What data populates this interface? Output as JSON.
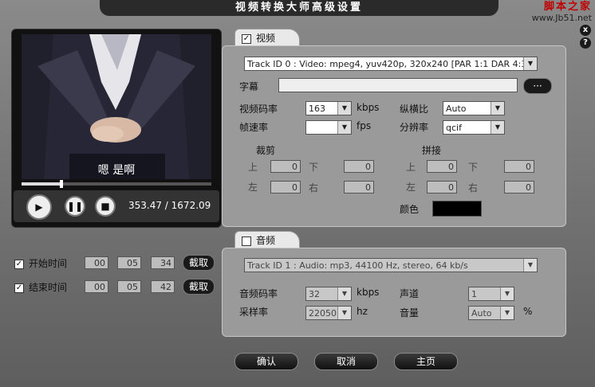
{
  "window": {
    "title": "视频转换大师高级设置"
  },
  "watermark": {
    "line1": "脚本之家",
    "line2": "www.Jb51.net"
  },
  "title_buttons": {
    "close": "x",
    "help": "?"
  },
  "player": {
    "subtitle": "嗯 是啊",
    "progress": 0.21,
    "timecode": "353.47 / 1672.09"
  },
  "clip": {
    "start": {
      "label": "开始时间",
      "h": "00",
      "m": "05",
      "s": "34",
      "capture": "截取",
      "checked": true
    },
    "end": {
      "label": "结束时间",
      "h": "00",
      "m": "05",
      "s": "42",
      "capture": "截取",
      "checked": true
    }
  },
  "video": {
    "tab_label": "视频",
    "checked": true,
    "track": "Track ID 0 : Video: mpeg4, yuv420p, 320x240 [PAR 1:1 DAR 4:3]",
    "subtitle_label": "字幕",
    "subtitle_value": "",
    "browse_label": "···",
    "bitrate_label": "视频码率",
    "bitrate_value": "163",
    "bitrate_unit": "kbps",
    "fps_label": "帧速率",
    "fps_value": "",
    "fps_unit": "fps",
    "aspect_label": "纵横比",
    "aspect_value": "Auto",
    "resolution_label": "分辨率",
    "resolution_value": "qcif",
    "crop": {
      "title": "裁剪",
      "top_label": "上",
      "top": "0",
      "bottom_label": "下",
      "bottom": "0",
      "left_label": "左",
      "left": "0",
      "right_label": "右",
      "right": "0"
    },
    "pad": {
      "title": "拼接",
      "top_label": "上",
      "top": "0",
      "bottom_label": "下",
      "bottom": "0",
      "left_label": "左",
      "left": "0",
      "right_label": "右",
      "right": "0"
    },
    "color_label": "颜色",
    "color_value": "#000000"
  },
  "audio": {
    "tab_label": "音频",
    "checked": false,
    "track": "Track ID 1 : Audio: mp3, 44100 Hz, stereo, 64 kb/s",
    "bitrate_label": "音频码率",
    "bitrate_value": "32",
    "bitrate_unit": "kbps",
    "samplerate_label": "采样率",
    "samplerate_value": "22050",
    "samplerate_unit": "hz",
    "channel_label": "声道",
    "channel_value": "1",
    "volume_label": "音量",
    "volume_value": "Auto",
    "volume_unit": "%"
  },
  "footer": {
    "ok": "确认",
    "cancel": "取消",
    "home": "主页"
  }
}
